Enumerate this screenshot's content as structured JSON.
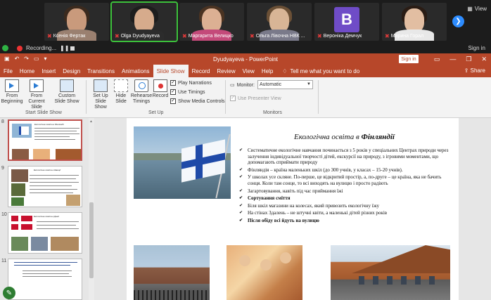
{
  "gallery": {
    "participants": [
      {
        "name": "Ксенія Фертак",
        "muted": true
      },
      {
        "name": "Olga Dyudyayeva",
        "muted": true
      },
      {
        "name": "Маргарита Велицко",
        "muted": true
      },
      {
        "name": "Ольга Лівочна НВК ...",
        "muted": true
      },
      {
        "name": "Вероніка Демчук",
        "muted": true,
        "avatar_letter": "B"
      },
      {
        "name": "Марина Горал",
        "muted": true
      }
    ],
    "view_label": "View"
  },
  "recording": {
    "label": "Recording...",
    "sign_in": "Sign in"
  },
  "window": {
    "title": "Dyudyayeva  -  PowerPoint",
    "sign_in_button": "Sign in",
    "share_label": "Share"
  },
  "menu": {
    "tabs": [
      "File",
      "Home",
      "Insert",
      "Design",
      "Transitions",
      "Animations",
      "Slide Show",
      "Record",
      "Review",
      "View",
      "Help"
    ],
    "active_tab": "Slide Show",
    "tell_me": "Tell me what you want to do"
  },
  "ribbon": {
    "start_group": {
      "label": "Start Slide Show",
      "from_beginning": "From Beginning",
      "from_current": "From Current Slide",
      "custom": "Custom Slide Show"
    },
    "setup_group": {
      "label": "Set Up",
      "setup_show": "Set Up Slide Show",
      "hide_slide": "Hide Slide",
      "rehearse": "Rehearse Timings",
      "record": "Record",
      "play_narrations": "Play Narrations",
      "use_timings": "Use Timings",
      "show_media_controls": "Show Media Controls"
    },
    "monitors_group": {
      "label": "Monitors",
      "monitor_label": "Monitor:",
      "monitor_value": "Automatic",
      "use_presenter_view": "Use Presenter View"
    }
  },
  "thumbnails": [
    {
      "number": "8",
      "title": "Екологічна освіта в Фінляндії",
      "selected": true
    },
    {
      "number": "9",
      "title": "Екологічна освіта в Швеції",
      "selected": false
    },
    {
      "number": "10",
      "title": "Екологічна освіта в Данії",
      "selected": false
    },
    {
      "number": "11",
      "title": "",
      "selected": false
    }
  ],
  "slide": {
    "title_prefix": "Екологічна освіта в ",
    "title_country": "Фінляндії",
    "bullets": [
      {
        "text": "Систематичне екологічне навчання починається з 5 років у спеціальних Центрах природи через залучення індивідуальної творчості дітей, екскурсії на природу, з ігровими моментами, що допомагають сприймати природу",
        "bold": false
      },
      {
        "text": "Фінляндія – країна маленьких шкіл (до 300 учнів, у класах – 15-20 учнів).",
        "bold": false
      },
      {
        "text": "У школах усе скляне. По-перше, це відкритий простір, а, по-друге – це країна, яка не бачить сонця. Коли там сонце, то всі виходять на вулицю і просто радіють",
        "bold": false
      },
      {
        "text": "Загартовування, навіть під час приймання їжі",
        "bold": false
      },
      {
        "text": "Сортування сміття",
        "bold": true
      },
      {
        "text": "Біля шкіл магазини на колесах, який привозить екологічну їжу",
        "bold": false
      },
      {
        "text": "На стінах 3далень – не штучні квіти, а маленькі дітей різних років",
        "bold": false
      },
      {
        "text": "Після обіду всі йдуть на вулицю",
        "bold": true
      }
    ]
  }
}
